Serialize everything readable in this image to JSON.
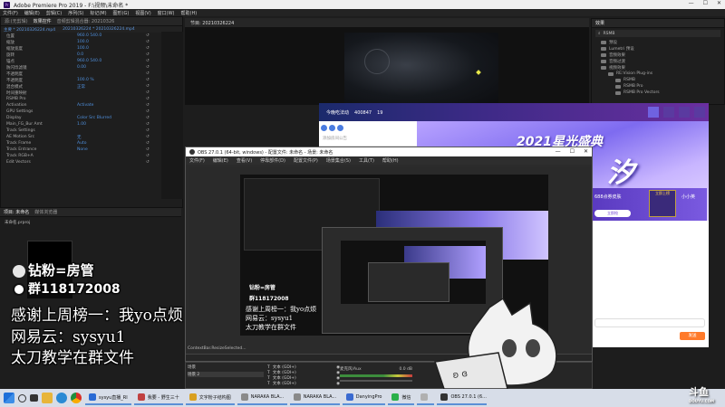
{
  "premiere": {
    "title": "Adobe Premiere Pro 2019 - F:\\视频\\未命名 *",
    "menu": [
      "文件(F)",
      "编辑(E)",
      "剪辑(C)",
      "序列(S)",
      "标记(M)",
      "图形(G)",
      "视图(V)",
      "窗口(W)",
      "帮助(H)"
    ],
    "effect_controls": {
      "tabs": [
        "源:(无剪辑)",
        "效果控件",
        "音频剪辑混合器: 20210326",
        "元数据"
      ],
      "clip_header": [
        "主要 * 20210326224.mp4",
        "20210326224 * 20210326224.mp4"
      ],
      "rows": [
        {
          "label": "位置",
          "value": "960.0  540.0"
        },
        {
          "label": "缩放",
          "value": "100.0"
        },
        {
          "label": "缩放宽度",
          "value": "100.0"
        },
        {
          "label": "旋转",
          "value": "0.0"
        },
        {
          "label": "锚点",
          "value": "960.0  540.0"
        },
        {
          "label": "防闪烁滤镜",
          "value": "0.00"
        },
        {
          "label": "不透明度",
          "value": ""
        },
        {
          "label": "不透明度",
          "value": "100.0 %"
        },
        {
          "label": "混合模式",
          "value": "正常"
        },
        {
          "label": "时间重映射",
          "value": ""
        },
        {
          "label": "RSMB Pro",
          "value": ""
        },
        {
          "label": "Activation",
          "value": "Activate"
        },
        {
          "label": "GPU Settings",
          "value": ""
        },
        {
          "label": "Display",
          "value": "Color Src Blurred"
        },
        {
          "label": "Main_FG_Bur Amt",
          "value": "1.00"
        },
        {
          "label": "Track Settings",
          "value": ""
        },
        {
          "label": "AE Motion Src",
          "value": "无"
        },
        {
          "label": "Track Frame",
          "value": "Auto"
        },
        {
          "label": "Track Entrance",
          "value": "None"
        },
        {
          "label": "Track RGB+A",
          "value": ""
        },
        {
          "label": "Edit Vectors",
          "value": ""
        }
      ]
    },
    "program_tab": "节目: 20210326224",
    "project_tabs": [
      "效果"
    ],
    "project_search": "RSMB",
    "project_tree": [
      "预设",
      "Lumetri 预设",
      "音频效果",
      "音频过渡",
      "视频效果",
      "RE:Vision Plug-ins",
      "RSMB",
      "RSMB Pro",
      "RSMB Pro Vectors"
    ],
    "lower_tabs": [
      "项目: 未命名",
      "媒体浏览器"
    ],
    "project_item": "未命名.prproj"
  },
  "overlay": {
    "line1": "钻粉=房管",
    "line2": "群118172008",
    "line3": "感谢上周榜一：我yo点烦",
    "line4": "网易云：sysyu1",
    "line5": "太刀教学在群文件"
  },
  "douyu": {
    "room_name": "今晚吃法动",
    "room_id": "400847",
    "stat": "19",
    "banner_text": "2021星光盛典",
    "notice_placeholder": "添加房间公告",
    "chat_item": "688点券皮肤",
    "chat_item2": "小小英",
    "chat_badge": "立即上榜",
    "footer_btn": "立即抢",
    "send": "发送"
  },
  "obs": {
    "title": "OBS 27.0.1 (64-bit, windows) - 配置文件: 未命名 - 场景: 未命名",
    "menu": [
      "文件(F)",
      "编辑(E)",
      "查看(V)",
      "停靠部件(D)",
      "配置文件(P)",
      "场景集合(S)",
      "工具(T)",
      "帮助(H)"
    ],
    "status": "ContextBar.ResizeSelected...",
    "scenes_title": "场景",
    "scene2": "场景 2",
    "sources": [
      "文本 (GDI+)",
      "文本 (GDI+)",
      "文本 (GDI+)",
      "文本 (GDI+)"
    ],
    "audio_label": "麦克风/Aux",
    "audio_db": "0.0 dB"
  },
  "taskbar": {
    "apps": [
      "sysyu直播_RI",
      "我要 - 野生三十",
      "文字粉子结构图",
      "NARAKA  BLA...",
      "NARAKA  BLA...",
      "DanyingPro",
      "微信",
      "",
      "OBS 27.0.1 (6..."
    ],
    "watermark": "斗鱼",
    "watermark_sub": "DOUYU.COM"
  },
  "colors": {
    "accent_blue": "#4f8fdc",
    "douyu_purple": "#7e6bf0",
    "taskbar": "#d7dde8"
  }
}
